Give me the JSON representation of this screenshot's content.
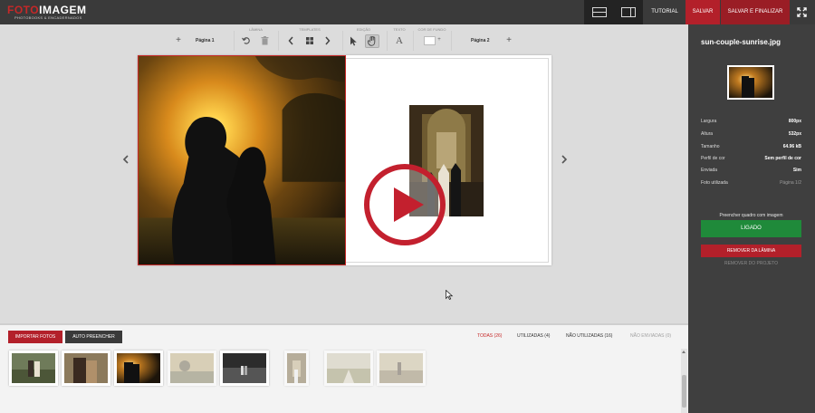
{
  "header": {
    "logo_brand_a": "FOTO",
    "logo_brand_b": "IMAGEM",
    "logo_tagline": "PHOTOBOOKS & ENCADERNADOS",
    "layout_single_icon": "single-page-layout-icon",
    "layout_double_icon": "double-page-layout-icon",
    "tutorial_label": "TUTORIAL",
    "save_label": "SALVAR",
    "save_finish_label": "SALVAR E FINALIZAR",
    "fullscreen_icon": "expand-arrows-icon"
  },
  "toolbar": {
    "page1_label": "Página 1",
    "page2_label": "Página 2",
    "group_lamina": "LÂMINA",
    "group_templates": "TEMPLATES",
    "group_edicao": "EDIÇÃO",
    "group_texto": "TEXTO",
    "group_cor": "COR DE FUNDO",
    "text_glyph": "A"
  },
  "canvas": {
    "play_icon": "play-icon",
    "prev_icon": "chevron-left-icon",
    "next_icon": "chevron-right-icon"
  },
  "bottom": {
    "import_label": "IMPORTAR FOTOS",
    "autofill_label": "AUTO PREENCHER",
    "filters": {
      "all": "TODAS (26)",
      "used": "UTILIZADAS (4)",
      "unused": "NÃO UTILIZADAS (16)",
      "not_sent": "NÃO ENVIADAS (0)"
    }
  },
  "panel": {
    "filename": "sun-couple-sunrise.jpg",
    "props": [
      {
        "label": "Largura",
        "value": "800px"
      },
      {
        "label": "Altura",
        "value": "532px"
      },
      {
        "label": "Tamanho",
        "value": "64.96 kB"
      },
      {
        "label": "Perfil de cor",
        "value": "Sem perfil de cor"
      },
      {
        "label": "Enviada",
        "value": "Sim"
      },
      {
        "label": "Foto utilizada",
        "value": "Página 1/2"
      }
    ],
    "fill_label": "Preencher quadro com imagem",
    "toggle_label": "LIGADO",
    "remove_sheet_label": "REMOVER DA LÂMINA",
    "remove_project_label": "REMOVER DO PROJETO"
  },
  "colors": {
    "accent_red": "#b3202a",
    "toggle_green": "#1f8a3a",
    "panel_bg": "#3f3f3f"
  }
}
